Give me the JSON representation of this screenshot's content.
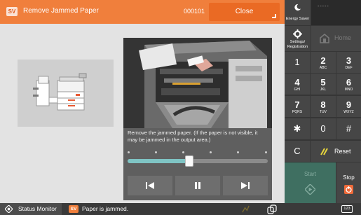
{
  "title_bar": {
    "badge": "SV",
    "title": "Remove Jammed Paper",
    "error_code": "000101",
    "close_label": "Close"
  },
  "video": {
    "caption": "Remove the jammed paper. (If the paper is not visible, it may be jammed in the output area.)",
    "progress": 0.44,
    "controls": [
      "skip-back",
      "pause",
      "skip-forward"
    ]
  },
  "status_bar": {
    "status_monitor_label": "Status Monitor",
    "alert_badge": "SV",
    "alert_text": "Paper is jammed.",
    "keypad_icon_label": "123"
  },
  "side_panel": {
    "energy_saver_label": "Energy Saver",
    "clock": "-----",
    "settings_label": "Settings/ Registration",
    "home_label": "Home",
    "keys": [
      {
        "digit": "1",
        "letters": ""
      },
      {
        "digit": "2",
        "letters": "ABC"
      },
      {
        "digit": "3",
        "letters": "DEF"
      },
      {
        "digit": "4",
        "letters": "GHI"
      },
      {
        "digit": "5",
        "letters": "JKL"
      },
      {
        "digit": "6",
        "letters": "MNO"
      },
      {
        "digit": "7",
        "letters": "PQRS"
      },
      {
        "digit": "8",
        "letters": "TUV"
      },
      {
        "digit": "9",
        "letters": "WXYZ"
      },
      {
        "digit": "✱",
        "letters": ""
      },
      {
        "digit": "0",
        "letters": ""
      },
      {
        "digit": "#",
        "letters": ""
      }
    ],
    "clear_label": "C",
    "reset_label": "Reset",
    "start_label": "Start",
    "stop_label": "Stop"
  },
  "colors": {
    "title_bar": "#f07f3c",
    "close_button": "#ea6a24",
    "timeline_fill": "#7fc4c4",
    "start_button": "#3f6f61",
    "stop_icon": "#ef6a3a",
    "reset_slash": "#e6d53c"
  }
}
